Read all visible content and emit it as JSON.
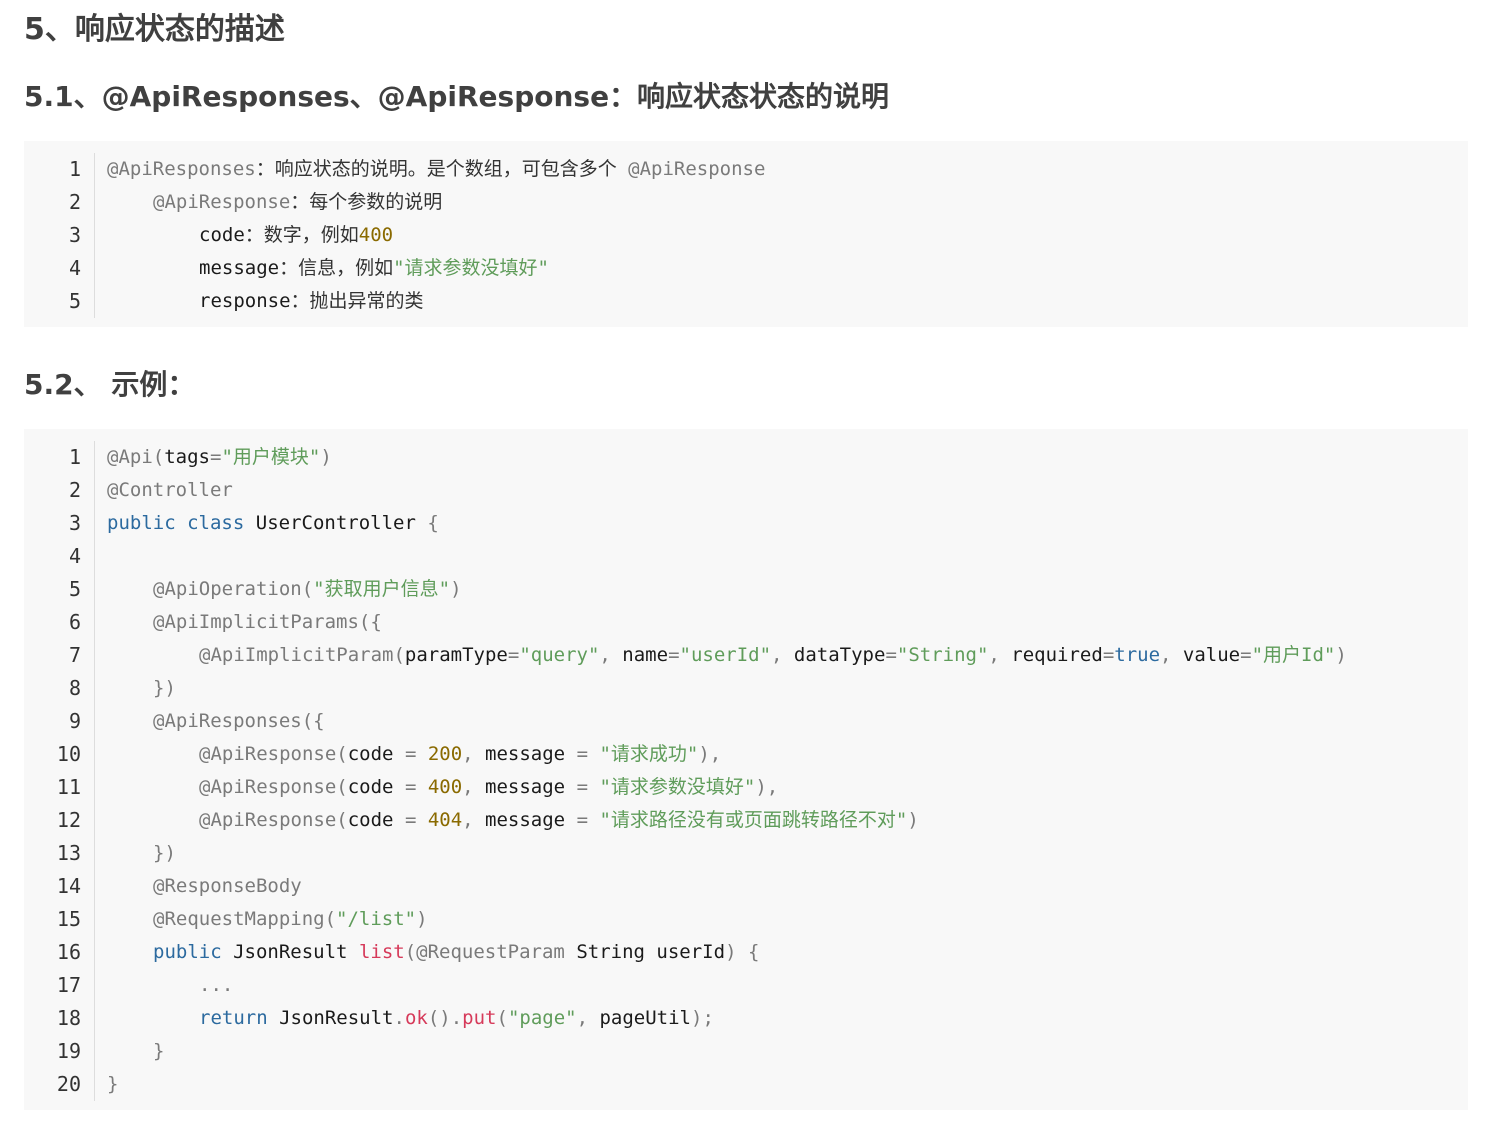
{
  "headings": {
    "h1": "5、响应状态的描述",
    "h2_a": "5.1、@ApiResponses、@ApiResponse：响应状态状态的说明",
    "h2_b": "5.2、 示例："
  },
  "code_block_1": {
    "line_numbers": [
      "1",
      "2",
      "3",
      "4",
      "5"
    ],
    "lines": {
      "l1_ann": "@ApiResponses",
      "l1_text": "：响应状态的说明。是个数组，可包含多个 ",
      "l1_ann2": "@ApiResponse",
      "l2_ann": "@ApiResponse",
      "l2_text": "：每个参数的说明",
      "l3_key": "code",
      "l3_text": "：数字，例如",
      "l3_num": "400",
      "l4_key": "message",
      "l4_text": "：信息，例如",
      "l4_str": "\"请求参数没填好\"",
      "l5_key": "response",
      "l5_text": "：抛出异常的类"
    }
  },
  "code_block_2": {
    "line_numbers": [
      "1",
      "2",
      "3",
      "4",
      "5",
      "6",
      "7",
      "8",
      "9",
      "10",
      "11",
      "12",
      "13",
      "14",
      "15",
      "16",
      "17",
      "18",
      "19",
      "20"
    ],
    "t": {
      "api": "@Api",
      "lp": "(",
      "rp": ")",
      "tags": "tags",
      "eq": "=",
      "tag_val": "\"用户模块\"",
      "controller": "@Controller",
      "public": "public",
      "class": "class",
      "user_controller": "UserController",
      "lbrace": "{",
      "rbrace": "}",
      "api_operation": "@ApiOperation",
      "op_val": "\"获取用户信息\"",
      "api_implicit_params": "@ApiImplicitParams",
      "open_arr": "({",
      "close_arr": "})",
      "api_implicit_param": "@ApiImplicitParam",
      "paramType": "paramType",
      "query": "\"query\"",
      "comma": ", ",
      "name": "name",
      "userId_str": "\"userId\"",
      "dataType": "dataType",
      "string_str": "\"String\"",
      "required": "required",
      "true": "true",
      "value": "value",
      "value_str": "\"用户Id\"",
      "api_responses": "@ApiResponses",
      "api_response": "@ApiResponse",
      "code": "code",
      "eq_sp": " = ",
      "n200": "200",
      "n400": "400",
      "n404": "404",
      "message": "message",
      "msg_ok": "\"请求成功\"",
      "msg_400": "\"请求参数没填好\"",
      "msg_404": "\"请求路径没有或页面跳转路径不对\"",
      "rp_comma": "),",
      "response_body": "@ResponseBody",
      "request_mapping": "@RequestMapping",
      "path_str": "\"/list\"",
      "json_result": "JsonResult",
      "list": "list",
      "request_param": "@RequestParam",
      "string_type": "String",
      "user_id": "userId",
      "rp_brace": ") {",
      "ellipsis": "...",
      "return": "return",
      "dot": ".",
      "ok": "ok",
      "parens": "()",
      "put": "put",
      "page_str": "\"page\"",
      "page_util": "pageUtil",
      "rp_semi": ");"
    }
  }
}
